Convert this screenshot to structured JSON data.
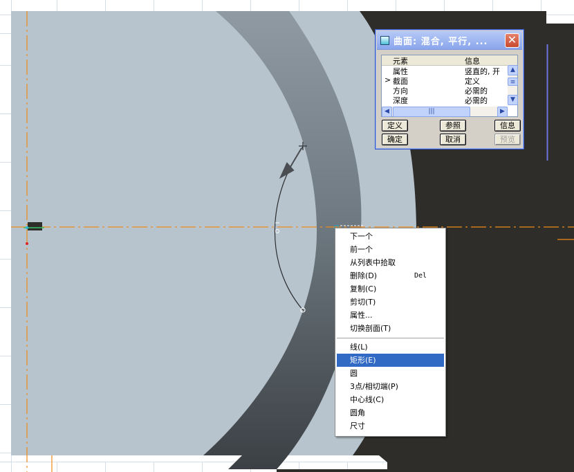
{
  "colors": {
    "grid_line": "#cfd7e0",
    "part_surface": "#b7c4cd",
    "band_light": "#8b969f",
    "band_dark": "#3a3f43",
    "background_dark": "#2e2d2a",
    "centerline": "#f08a18",
    "highlight": "#316ac5"
  },
  "dialog": {
    "title": "曲面: 混合, 平行, ...",
    "columns": [
      "元素",
      "信息"
    ],
    "rows": [
      {
        "marker": "",
        "element": "属性",
        "info": "竖直的, 开"
      },
      {
        "marker": ">",
        "element": "截面",
        "info": "定义"
      },
      {
        "marker": "",
        "element": "方向",
        "info": "必需的"
      },
      {
        "marker": "",
        "element": "深度",
        "info": "必需的"
      }
    ],
    "buttons": {
      "define": "定义",
      "reference": "参照",
      "info": "信息",
      "ok": "确定",
      "cancel": "取消",
      "preview": "预览"
    }
  },
  "context_menu": {
    "group1": [
      {
        "label": "下一个",
        "shortcut": ""
      },
      {
        "label": "前一个",
        "shortcut": ""
      },
      {
        "label": "从列表中拾取",
        "shortcut": ""
      },
      {
        "label": "删除(D)",
        "shortcut": "Del"
      },
      {
        "label": "复制(C)",
        "shortcut": ""
      },
      {
        "label": "剪切(T)",
        "shortcut": ""
      },
      {
        "label": "属性...",
        "shortcut": ""
      },
      {
        "label": "切换剖面(T)",
        "shortcut": ""
      }
    ],
    "group2": [
      {
        "label": "线(L)"
      },
      {
        "label": "矩形(E)",
        "highlighted": true
      },
      {
        "label": "圆"
      },
      {
        "label": "3点/相切端(P)"
      },
      {
        "label": "中心线(C)"
      },
      {
        "label": "圆角"
      },
      {
        "label": "尺寸"
      }
    ]
  }
}
